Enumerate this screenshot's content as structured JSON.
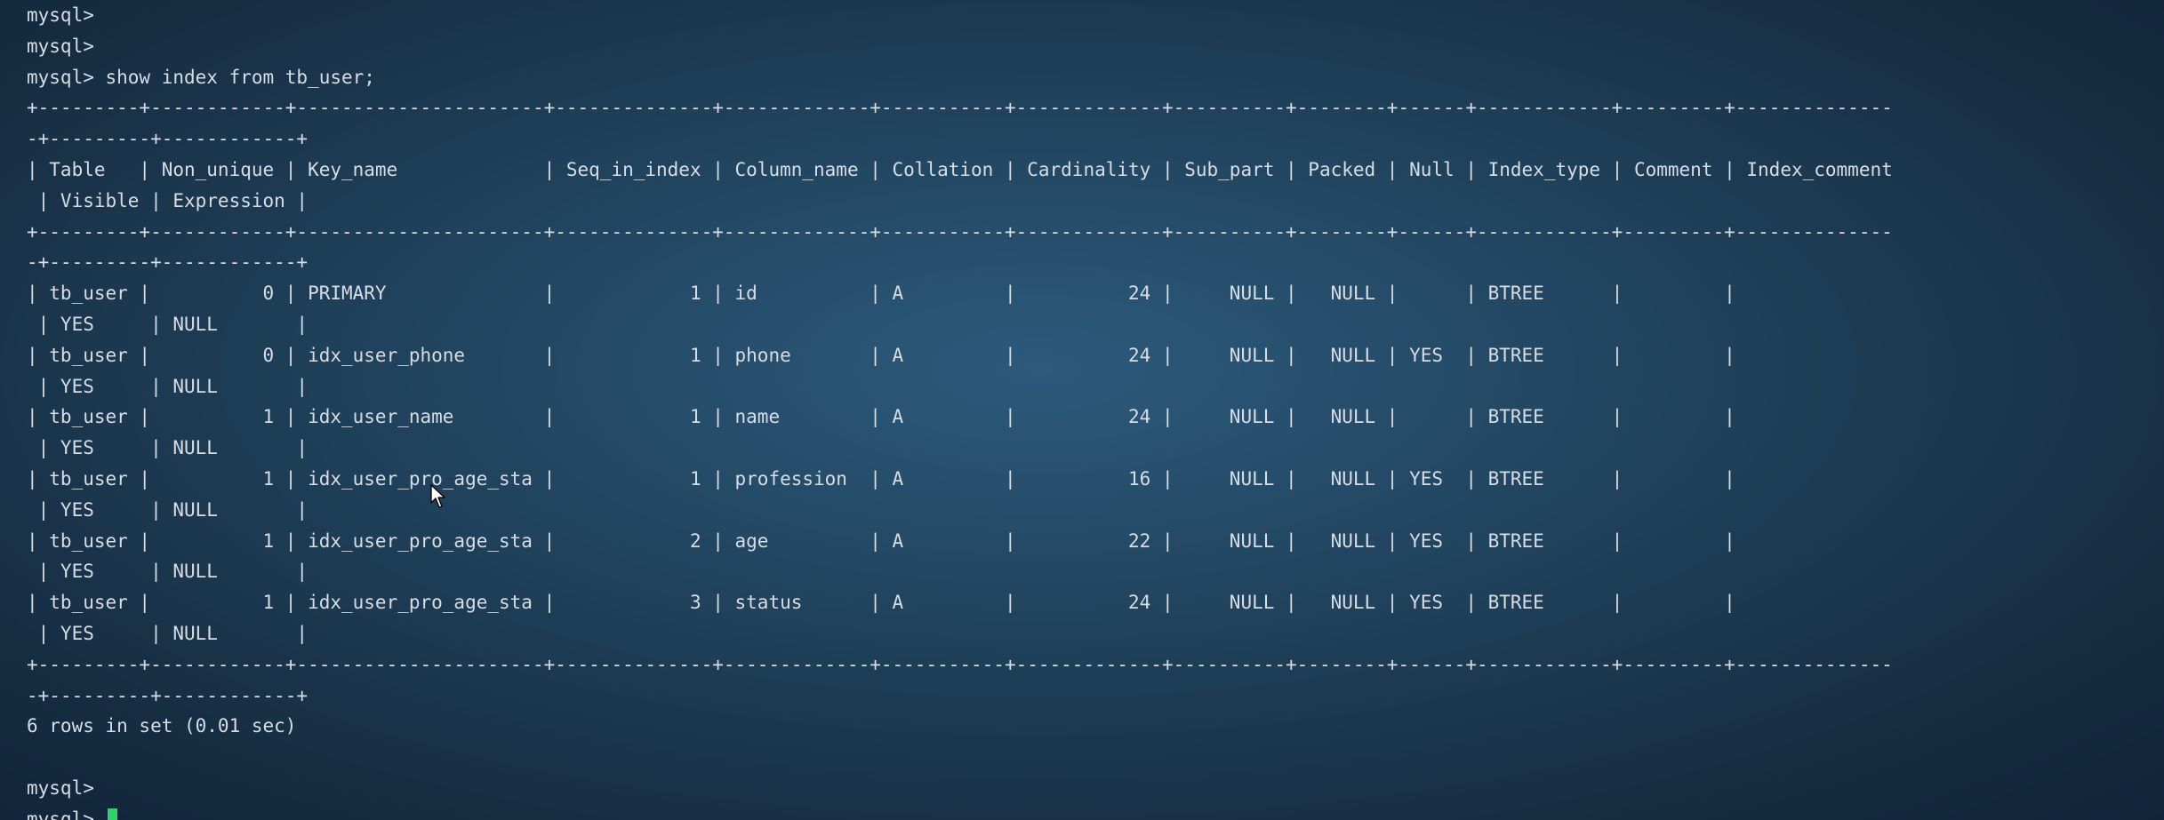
{
  "terminal": {
    "lines": [
      "mysql>",
      "mysql>",
      "mysql> show index from tb_user;",
      "+---------+------------+----------------------+--------------+-------------+-----------+-------------+----------+--------+------+------------+---------+--------------",
      "-+---------+------------+",
      "| Table   | Non_unique | Key_name             | Seq_in_index | Column_name | Collation | Cardinality | Sub_part | Packed | Null | Index_type | Comment | Index_comment",
      " | Visible | Expression |",
      "+---------+------------+----------------------+--------------+-------------+-----------+-------------+----------+--------+------+------------+---------+--------------",
      "-+---------+------------+",
      "| tb_user |          0 | PRIMARY              |            1 | id          | A         |          24 |     NULL |   NULL |      | BTREE      |         |",
      " | YES     | NULL       |",
      "| tb_user |          0 | idx_user_phone       |            1 | phone       | A         |          24 |     NULL |   NULL | YES  | BTREE      |         |",
      " | YES     | NULL       |",
      "| tb_user |          1 | idx_user_name        |            1 | name        | A         |          24 |     NULL |   NULL |      | BTREE      |         |",
      " | YES     | NULL       |",
      "| tb_user |          1 | idx_user_pro_age_sta |            1 | profession  | A         |          16 |     NULL |   NULL | YES  | BTREE      |         |",
      " | YES     | NULL       |",
      "| tb_user |          1 | idx_user_pro_age_sta |            2 | age         | A         |          22 |     NULL |   NULL | YES  | BTREE      |         |",
      " | YES     | NULL       |",
      "| tb_user |          1 | idx_user_pro_age_sta |            3 | status      | A         |          24 |     NULL |   NULL | YES  | BTREE      |         |",
      " | YES     | NULL       |",
      "+---------+------------+----------------------+--------------+-------------+-----------+-------------+----------+--------+------+------------+---------+--------------",
      "-+---------+------------+",
      "6 rows in set (0.01 sec)",
      "",
      "mysql>"
    ],
    "prompt": "mysql>",
    "text_color": "#d7dde3",
    "cursor_color": "#2fd36b"
  }
}
